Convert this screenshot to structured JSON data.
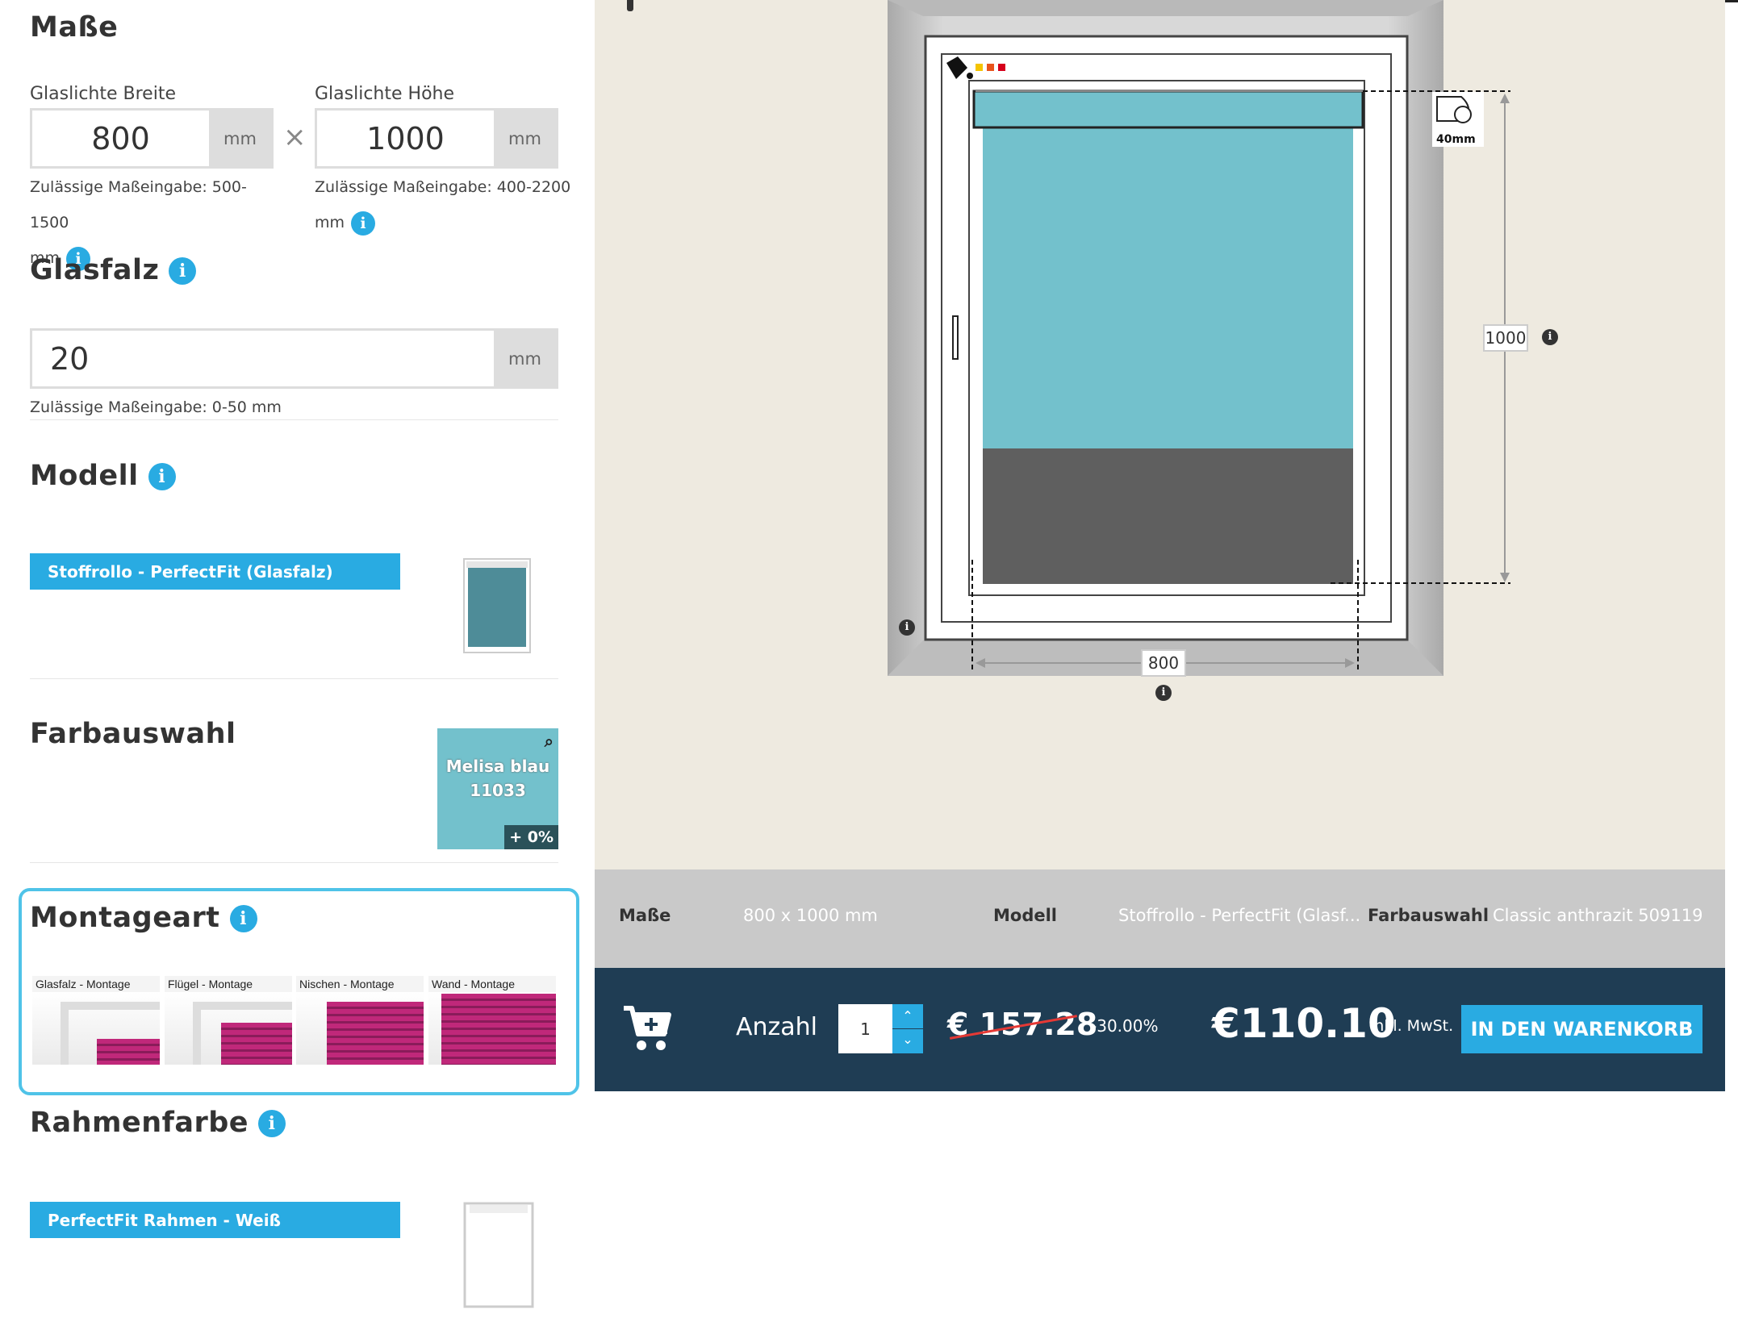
{
  "masse": {
    "title": "Maße",
    "width_label": "Glaslichte Breite",
    "width_value": "800",
    "height_label": "Glaslichte Höhe",
    "height_value": "1000",
    "unit": "mm",
    "times": "×",
    "width_hint": "Zulässige Maßeingabe: 500- 1500",
    "width_hint_unit": "mm",
    "height_hint": "Zulässige Maßeingabe: 400-2200",
    "height_hint_unit": "mm"
  },
  "glasfalz": {
    "title": "Glasfalz",
    "value": "20",
    "unit": "mm",
    "hint": "Zulässige Maßeingabe: 0-50 mm"
  },
  "modell": {
    "title": "Modell",
    "selected": "Stoffrollo - PerfectFit (Glasfalz)"
  },
  "farbauswahl": {
    "title": "Farbauswahl",
    "swatch_name_1": "Melisa blau",
    "swatch_name_2": "11033",
    "swatch_price": "+ 0%",
    "swatch_color": "#73c1cc"
  },
  "montageart": {
    "title": "Montageart",
    "options": [
      "Glasfalz - Montage",
      "Flügel - Montage",
      "Nischen - Montage",
      "Wand - Montage"
    ]
  },
  "rahmenfarbe": {
    "title": "Rahmenfarbe",
    "selected": "PerfectFit Rahmen - Weiß"
  },
  "preview": {
    "width_dim": "800",
    "height_dim": "1000",
    "cassette_label": "40mm",
    "fabric_color": "#73c1cc",
    "lower_color": "#5f5f5f",
    "color_dots": [
      "#f5c400",
      "#e8531c",
      "#d6001c"
    ]
  },
  "summary": {
    "masse_label": "Maße",
    "masse_value": "800 x 1000 mm",
    "modell_label": "Modell",
    "modell_value": "Stoffrollo - PerfectFit (Glasf...",
    "farb_label": "Farbauswahl",
    "farb_value": "Classic anthrazit 509119"
  },
  "cart": {
    "anzahl_label": "Anzahl",
    "quantity": "1",
    "old_price": "€ 157.28",
    "discount": "-30.00%",
    "price": "€110.10",
    "tax_note": "inkl. MwSt.",
    "button": "IN DEN WARENKORB"
  },
  "colors": {
    "accent": "#29abe2",
    "cart_bar": "#1f3d54",
    "summary_bar": "#c9c9c9",
    "preview_bg": "#eeeae0"
  }
}
